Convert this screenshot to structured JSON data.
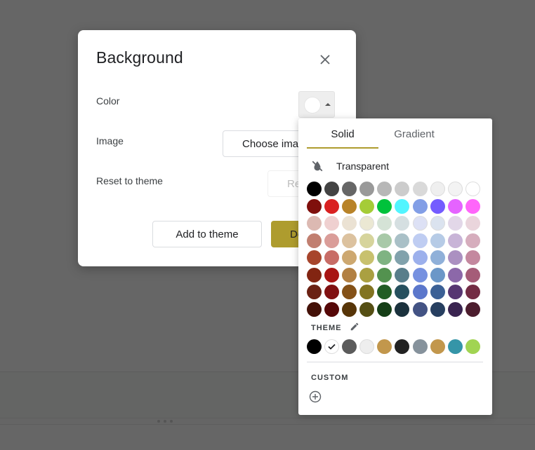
{
  "dialog": {
    "title": "Background",
    "close_icon": "close-icon",
    "rows": {
      "color_label": "Color",
      "image_label": "Image",
      "reset_label": "Reset to theme"
    },
    "selected_color": "#ffffff",
    "buttons": {
      "choose_image": "Choose image",
      "reset": "Reset",
      "add_to_theme": "Add to theme",
      "done": "Done"
    }
  },
  "picker": {
    "tabs": [
      {
        "label": "Solid",
        "active": true
      },
      {
        "label": "Gradient",
        "active": false
      }
    ],
    "transparent_label": "Transparent",
    "transparent_icon": "format-color-reset-icon",
    "palette": [
      [
        "#000000",
        "#434343",
        "#666666",
        "#999999",
        "#b7b7b7",
        "#cccccc",
        "#d9d9d9",
        "#efefef",
        "#f3f3f3",
        "#ffffff"
      ],
      [
        "#7f0f0c",
        "#d92020",
        "#b88328",
        "#a5cc37",
        "#00c23b",
        "#52f5ff",
        "#829ee6",
        "#745cff",
        "#e563ff",
        "#ff66fa"
      ],
      [
        "#dcb9b2",
        "#efd0d0",
        "#ebe2d3",
        "#ebe8d3",
        "#d5e3d6",
        "#d5dfe1",
        "#dde1f5",
        "#dbe3ef",
        "#e2d7e8",
        "#ead5dc"
      ],
      [
        "#c17f70",
        "#da9d99",
        "#dcc29f",
        "#d6d49c",
        "#a8c9a8",
        "#a9c0c7",
        "#bfcdf2",
        "#b6cbe6",
        "#c8b4d7",
        "#d6adbd"
      ],
      [
        "#a7452c",
        "#c86c66",
        "#cda870",
        "#c8c16e",
        "#7fb382",
        "#81a2ac",
        "#9cb0ec",
        "#8fb0d9",
        "#ab90c1",
        "#c4889f"
      ],
      [
        "#822512",
        "#a81514",
        "#b28042",
        "#aaa041",
        "#53924f",
        "#587e8b",
        "#7691e0",
        "#6b97c8",
        "#8c68a9",
        "#a55c78"
      ],
      [
        "#6b2113",
        "#801011",
        "#845117",
        "#827421",
        "#215d24",
        "#26505e",
        "#5b77cb",
        "#3b6095",
        "#573672",
        "#732c44"
      ],
      [
        "#441108",
        "#560808",
        "#573508",
        "#554f14",
        "#153f17",
        "#1b323d",
        "#435384",
        "#273f60",
        "#3a2450",
        "#4c1d2e"
      ]
    ],
    "theme_label": "THEME",
    "theme_edit_icon": "pencil-icon",
    "theme_colors": [
      "#000000",
      "#ffffff",
      "#5b5b5b",
      "#eeeeee",
      "#c2974c",
      "#222222",
      "#86929c",
      "#c2974c",
      "#3595a8",
      "#a1d452"
    ],
    "theme_selected_index": 1,
    "custom_label": "CUSTOM",
    "add_custom_icon": "add-circle-icon"
  }
}
